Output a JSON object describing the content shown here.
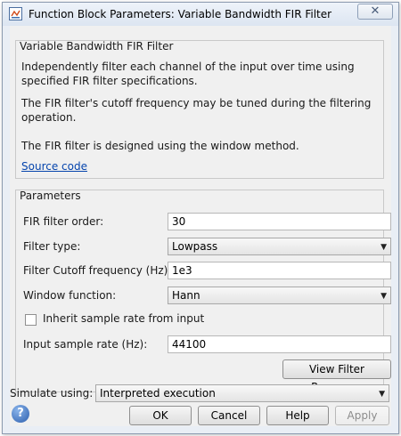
{
  "window": {
    "title": "Function Block Parameters: Variable Bandwidth FIR Filter",
    "close_glyph": "✕",
    "app_icon": "simulink-block-icon",
    "close_icon": "close-icon"
  },
  "block": {
    "name": "Variable Bandwidth FIR Filter",
    "description_1": "Independently filter each channel of the input over time using specified FIR filter specifications.",
    "description_2": "The FIR filter's cutoff frequency may be tuned during the filtering operation.",
    "description_3": "The FIR filter is designed using the window method.",
    "source_link": "Source code"
  },
  "parameters": {
    "title": "Parameters",
    "filter_order": {
      "label": "FIR filter order:",
      "value": "30"
    },
    "filter_type": {
      "label": "Filter type:",
      "value": "Lowpass"
    },
    "cutoff_frequency": {
      "label": "Filter Cutoff frequency (Hz):",
      "value": "1e3"
    },
    "window_function": {
      "label": "Window function:",
      "value": "Hann"
    },
    "inherit_sample_rate": {
      "label": "Inherit sample rate from input",
      "checked": false
    },
    "sample_rate": {
      "label": "Input sample rate (Hz):",
      "value": "44100"
    },
    "view_response_label": "View Filter Response"
  },
  "simulate": {
    "label": "Simulate using:",
    "value": "Interpreted execution"
  },
  "buttons": {
    "help_icon_glyph": "?",
    "ok": "OK",
    "cancel": "Cancel",
    "help": "Help",
    "apply": "Apply"
  },
  "colors": {
    "link": "#0645ad",
    "help_icon": "#2d5fae",
    "disabled_text": "#8c8c8c"
  }
}
